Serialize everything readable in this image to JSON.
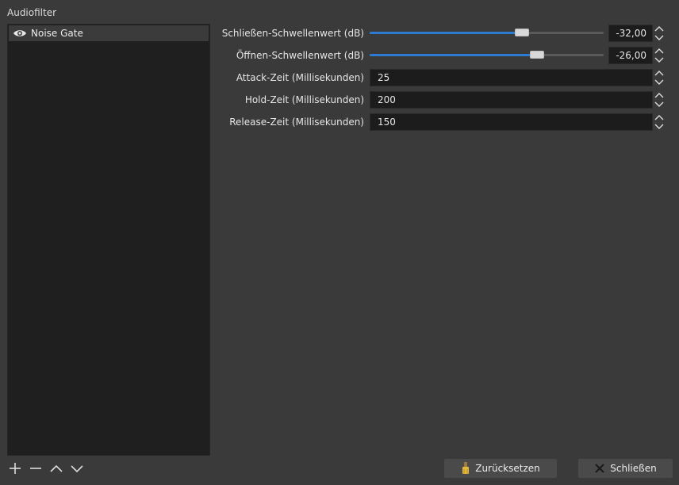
{
  "panel": {
    "title": "Audiofilter"
  },
  "filters": [
    {
      "label": "Noise Gate",
      "visible": true
    }
  ],
  "list_tools": {
    "add_icon": "plus-icon",
    "remove_icon": "minus-icon",
    "up_icon": "chevron-up-icon",
    "down_icon": "chevron-down-icon"
  },
  "properties": {
    "close_threshold": {
      "label": "Schließen-Schwellenwert (dB)",
      "value": "-32,00",
      "slider_fraction": 0.65
    },
    "open_threshold": {
      "label": "Öffnen-Schwellenwert (dB)",
      "value": "-26,00",
      "slider_fraction": 0.715
    },
    "attack": {
      "label": "Attack-Zeit (Millisekunden)",
      "value": "25"
    },
    "hold": {
      "label": "Hold-Zeit (Millisekunden)",
      "value": "200"
    },
    "release": {
      "label": "Release-Zeit (Millisekunden)",
      "value": "150"
    }
  },
  "buttons": {
    "reset": "Zurücksetzen",
    "close": "Schließen"
  },
  "colors": {
    "accent": "#2d7bd1",
    "background": "#3a3a3a",
    "list_background": "#1f1f1f"
  }
}
